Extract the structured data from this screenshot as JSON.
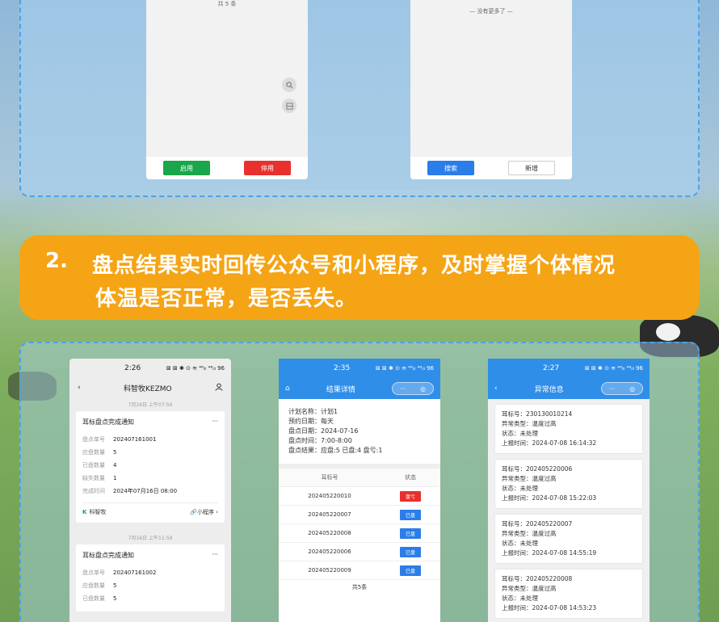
{
  "top": {
    "left": {
      "total_text": "共 5 条",
      "enable_label": "启用",
      "disable_label": "停用",
      "icon_search": "search-icon",
      "icon_scan": "scan-icon"
    },
    "right": {
      "no_more_text": "— 没有更多了 —",
      "search_label": "搜索",
      "add_label": "新增"
    }
  },
  "banner": {
    "number": "2.",
    "line1": "盘点结果实时回传公众号和小程序，及时掌握个体情况",
    "line2": "体温是否正常，是否丢失。"
  },
  "phone1": {
    "time": "2:26",
    "status_icons": "⊠ ⊠ ✱ ⊙ ≋ ⁴⁶ᵢₗₗ ⁴⁶ᵢₗₗ 96",
    "title": "科智牧KEZMO",
    "date1": "7月16日 上午07:59",
    "date2": "7月16日 上午11:59",
    "card1": {
      "title": "耳标盘点完成通知",
      "rows": [
        {
          "k": "盘点单号",
          "v": "202407161001"
        },
        {
          "k": "应盘数量",
          "v": "5"
        },
        {
          "k": "已盘数量",
          "v": "4"
        },
        {
          "k": "缺失数量",
          "v": "1"
        },
        {
          "k": "完成时间",
          "v": "2024年07月16日 08:00"
        }
      ],
      "brand": "科智牧",
      "mini": "小程序"
    },
    "card2": {
      "title": "耳标盘点完成通知",
      "rows": [
        {
          "k": "盘点单号",
          "v": "202407161002"
        },
        {
          "k": "应盘数量",
          "v": "5"
        },
        {
          "k": "已盘数量",
          "v": "5"
        }
      ]
    }
  },
  "phone2": {
    "time": "2:35",
    "status_icons": "⊠ ⊠ ✱ ⊙ ≋ ⁴⁶ᵢₗₗ ⁴⁶ᵢₗₗ 96",
    "title": "结果详情",
    "info": [
      "计划名称：计划1",
      "预约日期：每天",
      "盘点日期：2024-07-16",
      "盘点时间：7:00-8:00",
      "盘点结果：应盘:5 已盘:4 盘亏:1"
    ],
    "col_tag": "耳标号",
    "col_status": "状态",
    "rows": [
      {
        "tag": "202405220010",
        "status": "盘亏",
        "color": "red"
      },
      {
        "tag": "202405220007",
        "status": "已盘",
        "color": "blue"
      },
      {
        "tag": "202405220008",
        "status": "已盘",
        "color": "blue"
      },
      {
        "tag": "202405220006",
        "status": "已盘",
        "color": "blue"
      },
      {
        "tag": "202405220009",
        "status": "已盘",
        "color": "blue"
      }
    ],
    "total": "共5条"
  },
  "phone3": {
    "time": "2:27",
    "status_icons": "⊠ ⊠ ✱ ⊙ ≋ ⁴⁶ᵢₗₗ ⁴⁶ᵢₗₗ 96",
    "title": "异常信息",
    "items": [
      {
        "tag": "耳标号：230130010214",
        "type": "异常类型：温度过高",
        "state": "状态：未处理",
        "time": "上报时间：2024-07-08 16:14:32"
      },
      {
        "tag": "耳标号：202405220006",
        "type": "异常类型：温度过高",
        "state": "状态：未处理",
        "time": "上报时间：2024-07-08 15:22:03"
      },
      {
        "tag": "耳标号：202405220007",
        "type": "异常类型：温度过高",
        "state": "状态：未处理",
        "time": "上报时间：2024-07-08 14:55:19"
      },
      {
        "tag": "耳标号：202405220008",
        "type": "异常类型：温度过高",
        "state": "状态：未处理",
        "time": "上报时间：2024-07-08 14:53:23"
      }
    ]
  },
  "colors": {
    "accent": "#2f8ee8",
    "banner": "#f5a415",
    "danger": "#e8302e",
    "success": "#1aa64a"
  }
}
